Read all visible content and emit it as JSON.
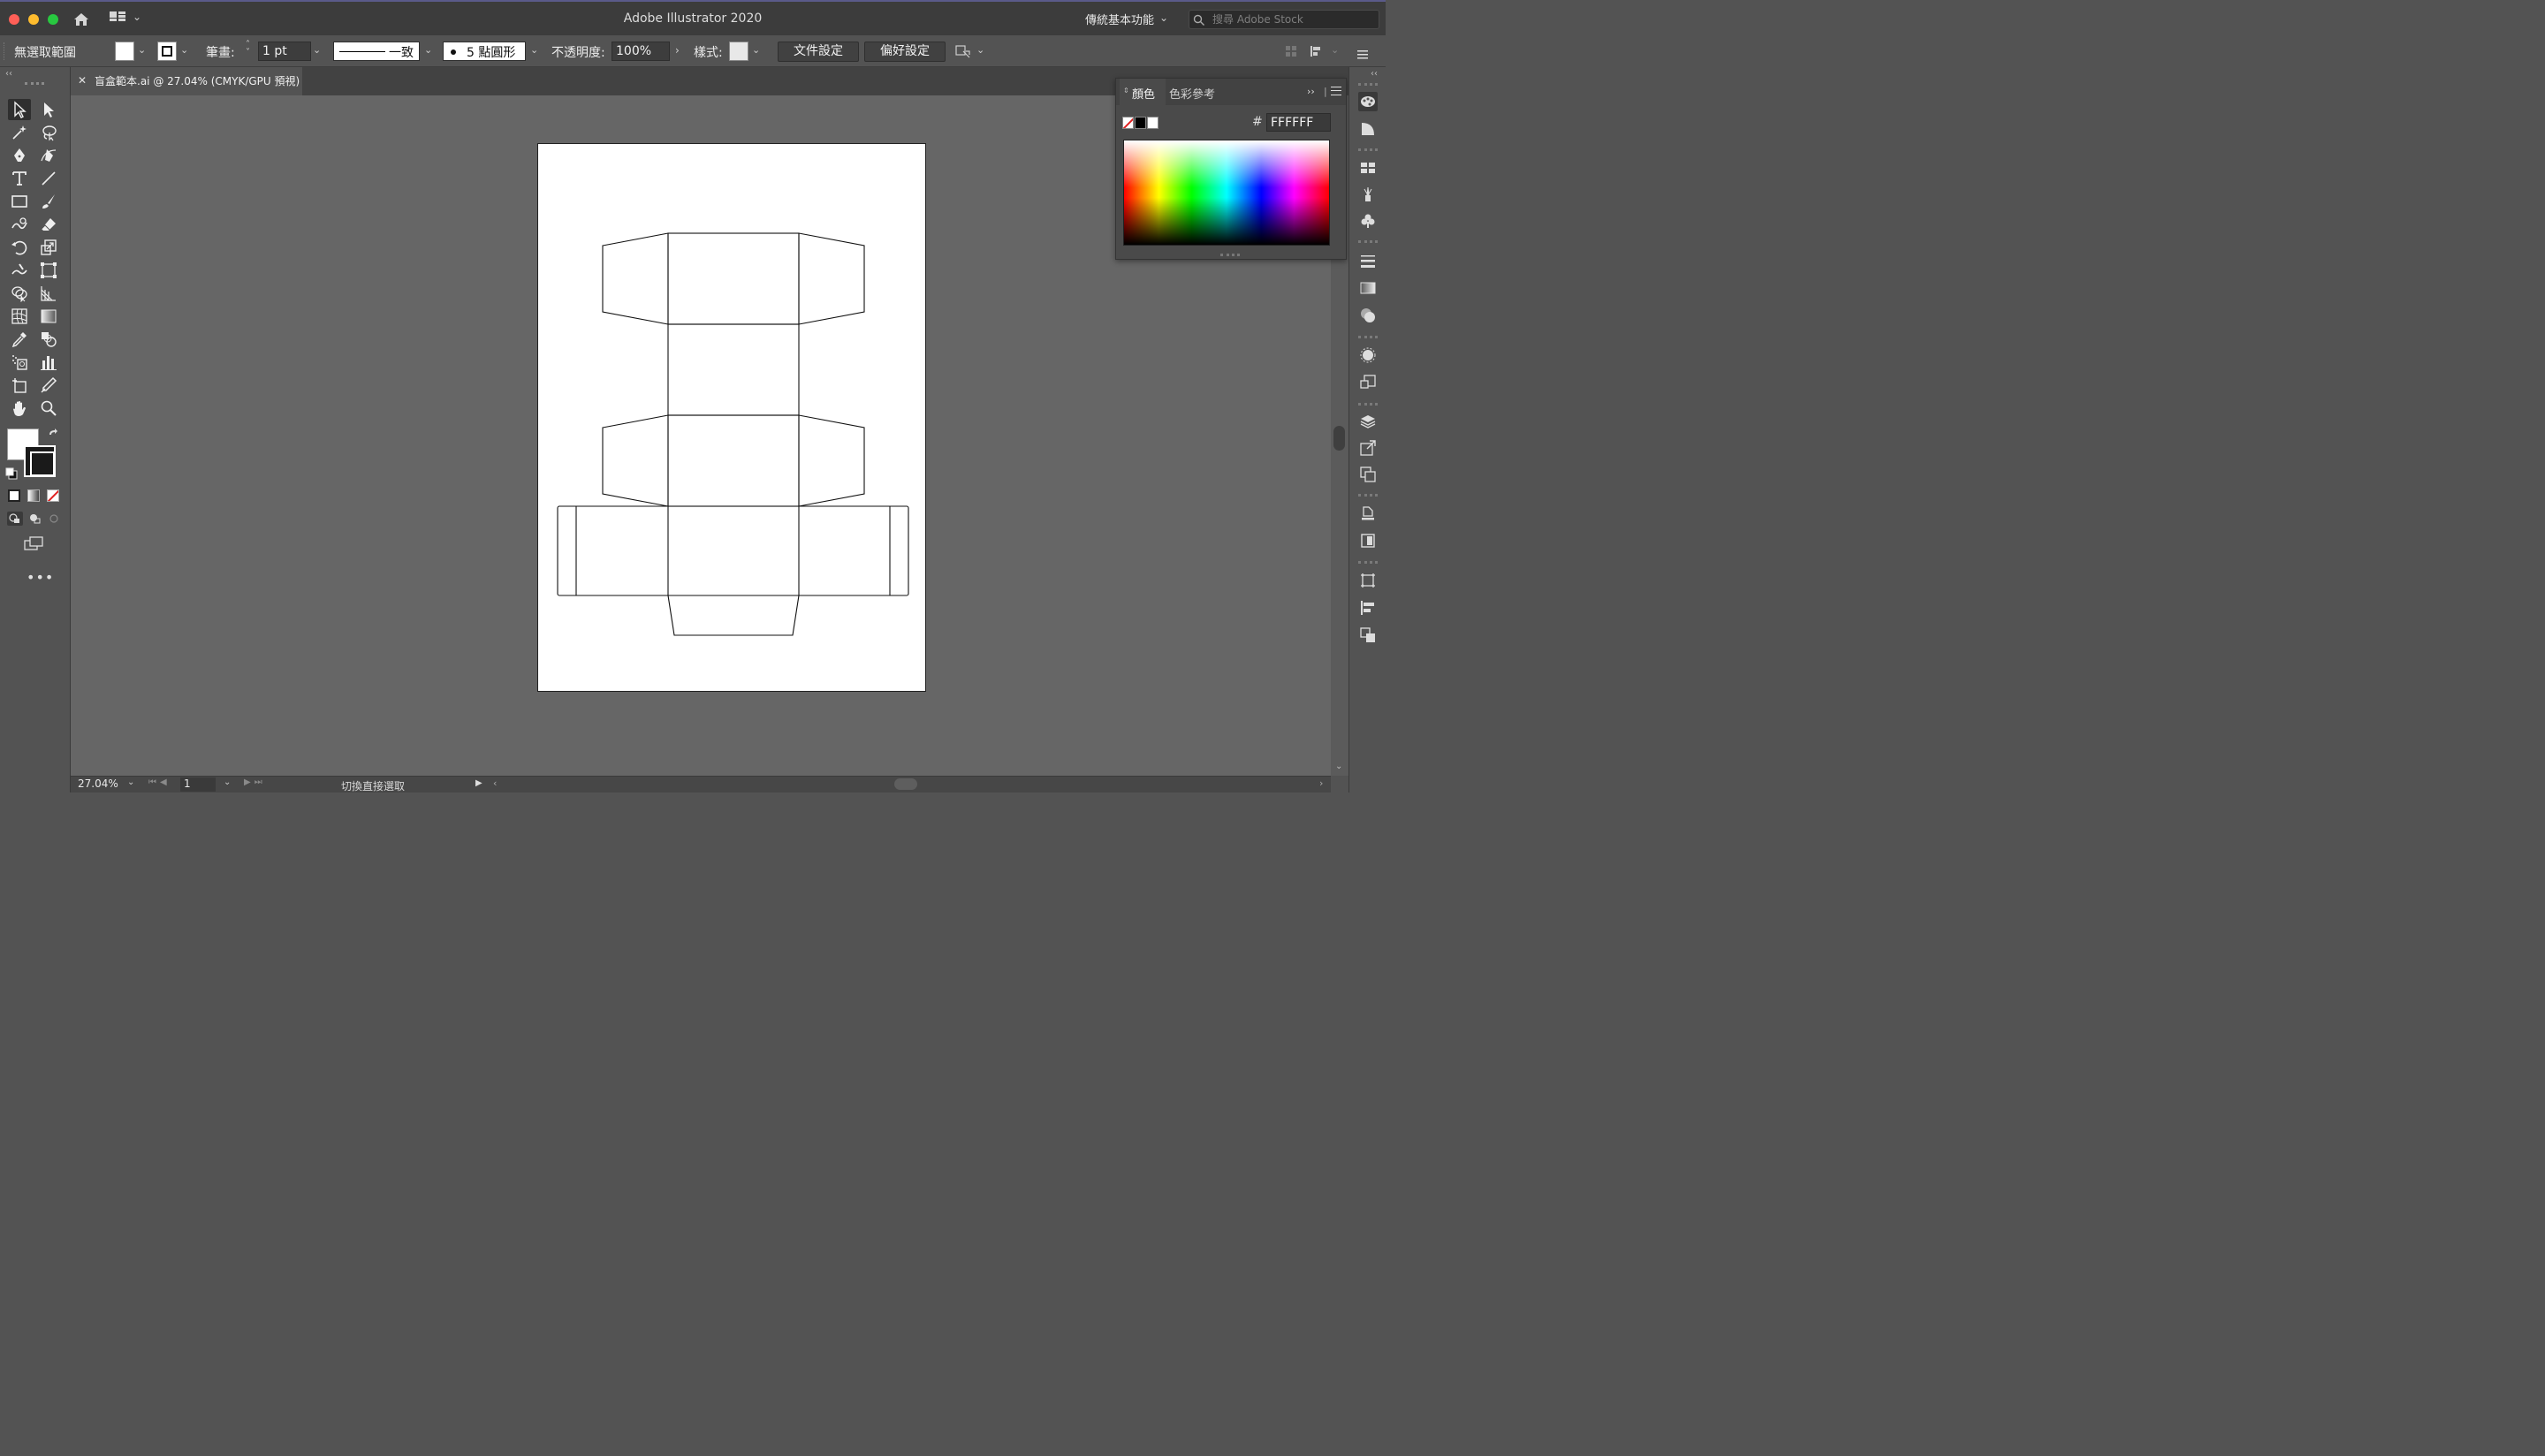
{
  "app": {
    "title": "Adobe Illustrator 2020"
  },
  "titlebar": {
    "workspace_label": "傳統基本功能",
    "stock_search_placeholder": "搜尋 Adobe Stock"
  },
  "controlbar": {
    "selection_label": "無選取範圍",
    "stroke_label": "筆畫:",
    "stroke_weight": "1 pt",
    "stroke_profile": "一致",
    "brush_label": "5 點圓形",
    "opacity_label": "不透明度:",
    "opacity_value": "100%",
    "style_label": "樣式:",
    "document_setup_button": "文件設定",
    "preferences_button": "偏好設定"
  },
  "document": {
    "tab_title": "盲盒範本.ai @ 27.04% (CMYK/GPU 預視)"
  },
  "statusbar": {
    "zoom": "27.04%",
    "page": "1",
    "status_text": "切換直接選取"
  },
  "color_panel": {
    "tab_color": "顏色",
    "tab_color_guide": "色彩參考",
    "hash": "#",
    "hex_value": "FFFFFF"
  },
  "colors": {
    "chrome_bg": "#535353",
    "canvas_bg": "#666666",
    "titlebar_bg": "#3c3c3c",
    "fill_color": "#FFFFFF",
    "stroke_color": "#000000"
  },
  "tools": [
    "selection-tool",
    "direct-selection-tool",
    "magic-wand-tool",
    "lasso-tool",
    "pen-tool",
    "curvature-tool",
    "type-tool",
    "line-segment-tool",
    "rectangle-tool",
    "paintbrush-tool",
    "shaper-tool",
    "eraser-tool",
    "rotate-tool",
    "scale-tool",
    "warp-tool",
    "free-transform-tool",
    "shape-builder-tool",
    "perspective-grid-tool",
    "mesh-tool",
    "gradient-tool",
    "eyedropper-tool",
    "blend-tool",
    "symbol-sprayer-tool",
    "column-graph-tool",
    "artboard-tool",
    "slice-tool",
    "hand-tool",
    "zoom-tool"
  ]
}
